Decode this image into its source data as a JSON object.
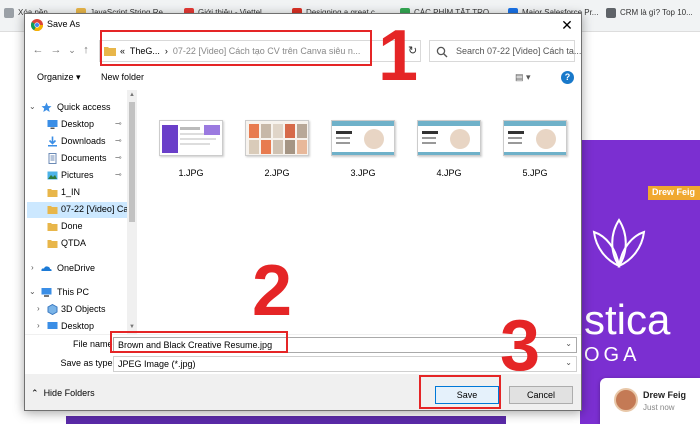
{
  "browser": {
    "tabs": [
      {
        "label": "Xóa nền",
        "color": "#9aa0a6"
      },
      {
        "label": "JavaScript String Re...",
        "color": "#e8b64a"
      },
      {
        "label": "Giới thiệu - Viettel",
        "color": "#e53935"
      },
      {
        "label": "Designing a great c...",
        "color": "#d93025"
      },
      {
        "label": "CÁC PHÍM TẮT TRO...",
        "color": "#34a853"
      },
      {
        "label": "Major Salesforce Pr...",
        "color": "#1a73e8"
      },
      {
        "label": "CRM là gì? Top 10...",
        "color": "#5f6368"
      }
    ]
  },
  "background_page": {
    "name_tag": "Drew Feig",
    "brand_text": "stica",
    "brand_sub": "OGA",
    "chat_name": "Drew Feig",
    "chat_time": "Just now",
    "accent_purple": "#7b2fd1"
  },
  "dialog": {
    "title": "Save As",
    "close": "✕",
    "nav": {
      "back": "←",
      "forward": "→",
      "down": "⌄",
      "up": "↑"
    },
    "address": {
      "prefix": "«",
      "crumb1": "TheG...",
      "sep": "›",
      "crumb2": "07-22 [Video] Cách tạo CV trên Canva siêu n...",
      "drop": "⌄",
      "refresh": "↻"
    },
    "search_placeholder": "Search 07-22 [Video] Cách ta...",
    "toolbar": {
      "organize": "Organize ▾",
      "new_folder": "New folder",
      "view": "▤ ▾",
      "help": "?"
    },
    "sidebar": [
      {
        "label": "Quick access",
        "icon": "star-icon",
        "level": 0,
        "chevron": "⌄"
      },
      {
        "label": "Desktop",
        "icon": "desktop-icon",
        "level": 1,
        "pin": true
      },
      {
        "label": "Downloads",
        "icon": "download-icon",
        "level": 1,
        "pin": true
      },
      {
        "label": "Documents",
        "icon": "document-icon",
        "level": 1,
        "pin": true
      },
      {
        "label": "Pictures",
        "icon": "pictures-icon",
        "level": 1,
        "pin": true
      },
      {
        "label": "1_IN",
        "icon": "folder-icon",
        "level": 1
      },
      {
        "label": "07-22 [Video] Ca",
        "icon": "folder-icon",
        "level": 1,
        "selected": true
      },
      {
        "label": "Done",
        "icon": "folder-icon",
        "level": 1
      },
      {
        "label": "QTDA",
        "icon": "folder-icon",
        "level": 1
      },
      {
        "label": "OneDrive",
        "icon": "onedrive-icon",
        "level": 0,
        "chevron": "›"
      },
      {
        "label": "This PC",
        "icon": "pc-icon",
        "level": 0,
        "chevron": "⌄"
      },
      {
        "label": "3D Objects",
        "icon": "cube-icon",
        "level": 1,
        "chevron": "›"
      },
      {
        "label": "Desktop",
        "icon": "desktop-icon",
        "level": 1,
        "chevron": "›"
      }
    ],
    "pin_glyph": "📌",
    "files": [
      "1.JPG",
      "2.JPG",
      "3.JPG",
      "4.JPG",
      "5.JPG"
    ],
    "file_name_label": "File name:",
    "file_name_value": "Brown and Black Creative Resume.jpg",
    "save_type_label": "Save as type:",
    "save_type_value": "JPEG Image (*.jpg)",
    "dropdown_glyph": "⌄",
    "hide_folders": "Hide Folders",
    "save_button": "Save",
    "cancel_button": "Cancel"
  },
  "annotations": {
    "n1": "1",
    "n2": "2",
    "n3": "3",
    "color": "#e52526"
  }
}
